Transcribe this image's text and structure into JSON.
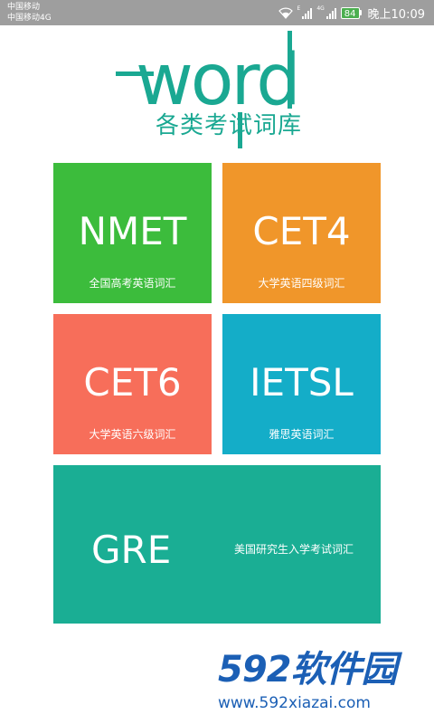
{
  "status_bar": {
    "carrier_1": "中国移动",
    "carrier_2": "中国移动4G",
    "net_label_1": "E",
    "net_label_2": "4G",
    "battery": "84",
    "clock": "晚上10:09"
  },
  "logo": {
    "word": "word",
    "subtitle": "各类考试词库",
    "color": "#1aa892"
  },
  "tiles": [
    {
      "name": "NMET",
      "desc": "全国高考英语词汇",
      "color": "#3cbc3c"
    },
    {
      "name": "CET4",
      "desc": "大学英语四级词汇",
      "color": "#f0962a"
    },
    {
      "name": "CET6",
      "desc": "大学英语六级词汇",
      "color": "#f76e5a"
    },
    {
      "name": "IETSL",
      "desc": "雅思英语词汇",
      "color": "#14adc8"
    },
    {
      "name": "GRE",
      "desc": "美国研究生入学考试词汇",
      "color": "#1aae94"
    }
  ],
  "watermark": {
    "logo": "592软件园",
    "url": "www.592xiazai.com"
  }
}
